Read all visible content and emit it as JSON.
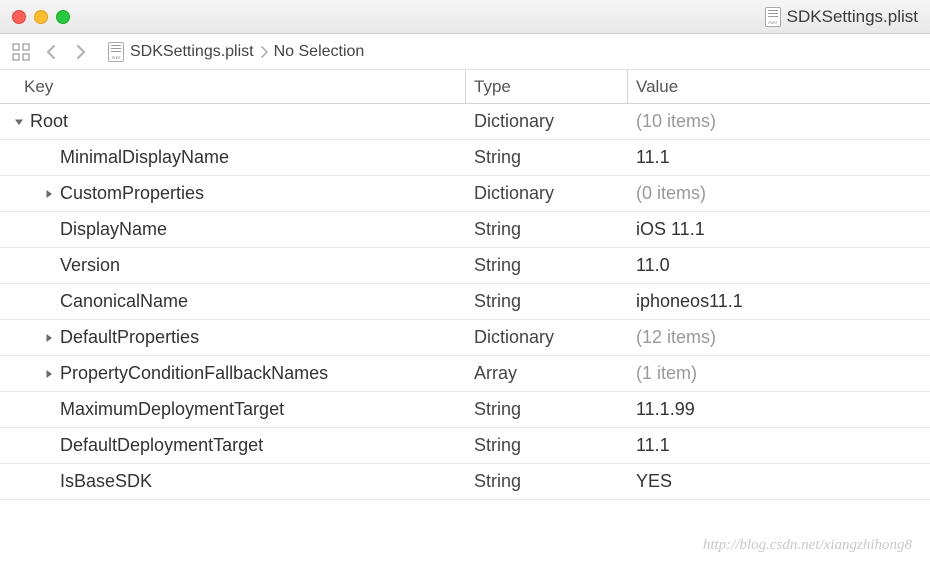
{
  "window": {
    "title": "SDKSettings.plist"
  },
  "breadcrumb": {
    "file": "SDKSettings.plist",
    "selection": "No Selection"
  },
  "table": {
    "headers": {
      "key": "Key",
      "type": "Type",
      "value": "Value"
    },
    "rows": [
      {
        "key": "Root",
        "type": "Dictionary",
        "value": "(10 items)",
        "indent": 0,
        "disclosure": "open",
        "muted": true
      },
      {
        "key": "MinimalDisplayName",
        "type": "String",
        "value": "11.1",
        "indent": 1,
        "disclosure": "none",
        "muted": false
      },
      {
        "key": "CustomProperties",
        "type": "Dictionary",
        "value": "(0 items)",
        "indent": 1,
        "disclosure": "closed",
        "muted": true
      },
      {
        "key": "DisplayName",
        "type": "String",
        "value": "iOS 11.1",
        "indent": 1,
        "disclosure": "none",
        "muted": false
      },
      {
        "key": "Version",
        "type": "String",
        "value": "11.0",
        "indent": 1,
        "disclosure": "none",
        "muted": false
      },
      {
        "key": "CanonicalName",
        "type": "String",
        "value": "iphoneos11.1",
        "indent": 1,
        "disclosure": "none",
        "muted": false
      },
      {
        "key": "DefaultProperties",
        "type": "Dictionary",
        "value": "(12 items)",
        "indent": 1,
        "disclosure": "closed",
        "muted": true
      },
      {
        "key": "PropertyConditionFallbackNames",
        "type": "Array",
        "value": "(1 item)",
        "indent": 1,
        "disclosure": "closed",
        "muted": true
      },
      {
        "key": "MaximumDeploymentTarget",
        "type": "String",
        "value": "11.1.99",
        "indent": 1,
        "disclosure": "none",
        "muted": false
      },
      {
        "key": "DefaultDeploymentTarget",
        "type": "String",
        "value": "11.1",
        "indent": 1,
        "disclosure": "none",
        "muted": false
      },
      {
        "key": "IsBaseSDK",
        "type": "String",
        "value": "YES",
        "indent": 1,
        "disclosure": "none",
        "muted": false
      }
    ]
  },
  "watermark": "http://blog.csdn.net/xiangzhihong8"
}
